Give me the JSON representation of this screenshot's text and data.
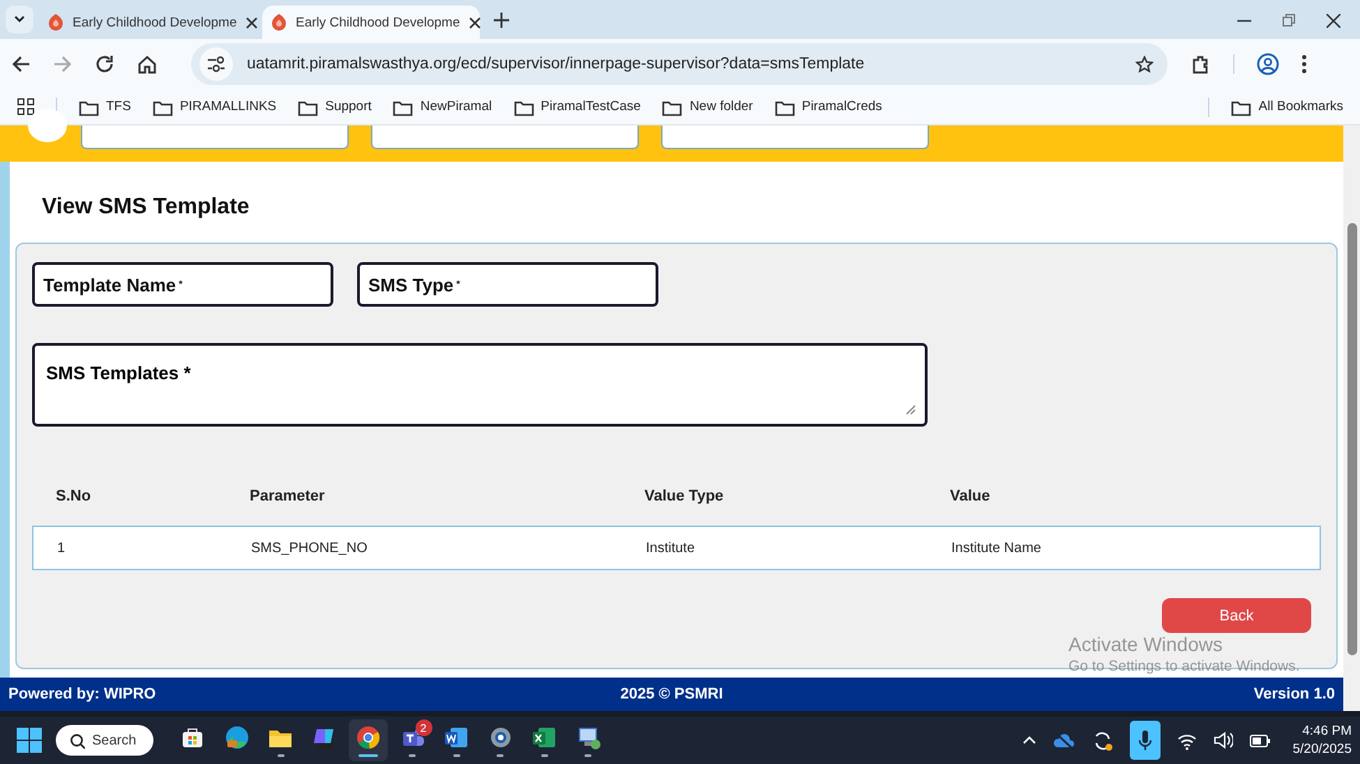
{
  "browser": {
    "tabs": [
      {
        "title": "Early Childhood Developme",
        "selected": false
      },
      {
        "title": "Early Childhood Developme",
        "selected": true
      }
    ],
    "url": "uatamrit.piramalswasthya.org/ecd/supervisor/innerpage-supervisor?data=smsTemplate",
    "bookmarks": [
      "TFS",
      "PIRAMALLINKS",
      "Support",
      "NewPiramal",
      "PiramalTestCase",
      "New folder",
      "PiramalCreds"
    ],
    "all_bookmarks": "All Bookmarks"
  },
  "page": {
    "title": "View SMS Template",
    "fields": [
      {
        "label": "Template Name",
        "mark": "*"
      },
      {
        "label": "SMS Type",
        "mark": "*"
      }
    ],
    "textarea": {
      "label": "SMS Templates *"
    },
    "table": {
      "columns": [
        "S.No",
        "Parameter",
        "Value Type",
        "Value"
      ],
      "rows": [
        [
          "1",
          "SMS_PHONE_NO",
          "Institute",
          "Institute Name"
        ]
      ]
    },
    "back_button": "Back"
  },
  "footer": {
    "left": "Powered by: WIPRO",
    "center": "2025 © PSMRI",
    "right": "Version 1.0"
  },
  "activation_notice": {
    "title": "Activate Windows",
    "text": "Go to Settings to activate Windows."
  },
  "taskbar": {
    "search": "Search",
    "apps": [
      {
        "kind": "store",
        "running": false,
        "selected": false
      },
      {
        "kind": "edge",
        "running": false,
        "selected": false
      },
      {
        "kind": "explorer",
        "running": true,
        "selected": false
      },
      {
        "kind": "m365",
        "running": false,
        "selected": false
      },
      {
        "kind": "chrome",
        "running": true,
        "selected": true
      },
      {
        "kind": "teams",
        "running": true,
        "selected": false,
        "badge": "2"
      },
      {
        "kind": "word",
        "running": true,
        "selected": false
      },
      {
        "kind": "settings",
        "running": true,
        "selected": false
      },
      {
        "kind": "excel",
        "running": true,
        "selected": false
      },
      {
        "kind": "remote",
        "running": true,
        "selected": false
      }
    ],
    "time": "4:46 PM",
    "date": "5/20/2025"
  }
}
